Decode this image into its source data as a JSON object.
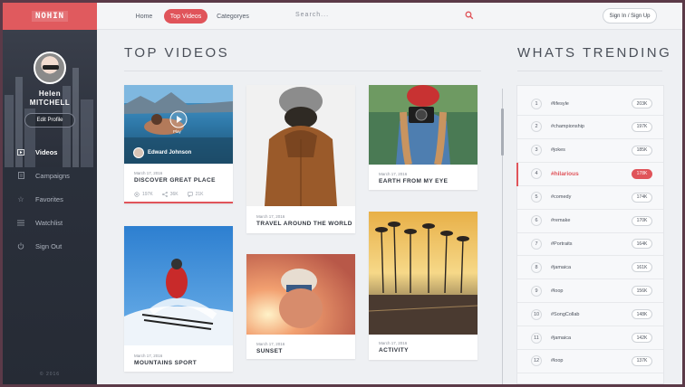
{
  "brand": {
    "logo_text": "NOHIN"
  },
  "profile": {
    "first_name": "Helen",
    "last_name": "MITCHELL",
    "edit_label": "Edit Profile"
  },
  "sidebar": {
    "items": [
      {
        "label": "Videos",
        "icon": "play-icon",
        "active": true
      },
      {
        "label": "Campaigns",
        "icon": "document-icon",
        "active": false
      },
      {
        "label": "Favorites",
        "icon": "star-icon",
        "active": false
      },
      {
        "label": "Watchlist",
        "icon": "list-icon",
        "active": false
      },
      {
        "label": "Sign Out",
        "icon": "power-icon",
        "active": false
      }
    ],
    "copyright": "© 2016"
  },
  "topnav": {
    "items": [
      {
        "label": "Home",
        "active": false
      },
      {
        "label": "Top Videos",
        "active": true
      },
      {
        "label": "Categoryes",
        "active": false
      }
    ],
    "search_placeholder": "Search...",
    "signin_label": "Sign In / Sign Up"
  },
  "sections": {
    "top_videos": "TOP VIDEOS",
    "trending": "WHATS TRENDING"
  },
  "videos": [
    {
      "date": "March 17, 2016",
      "title": "DISCOVER GREAT PLACE",
      "author": "Edward Johnson",
      "play_label": "Play",
      "views": "197K",
      "shares": "36K",
      "comments": "21K"
    },
    {
      "date": "March 17, 2016",
      "title": "MOUNTAINS SPORT"
    },
    {
      "date": "March 17, 2016",
      "title": "TRAVEL AROUND THE WORLD"
    },
    {
      "date": "March 17, 2016",
      "title": "SUNSET"
    },
    {
      "date": "March 17, 2016",
      "title": "EARTH FROM MY EYE"
    },
    {
      "date": "March 17, 2016",
      "title": "ACTIVITY"
    }
  ],
  "trending": [
    {
      "rank": "1",
      "tag": "#lifesyle",
      "count": "203K"
    },
    {
      "rank": "2",
      "tag": "#championship",
      "count": "197K"
    },
    {
      "rank": "3",
      "tag": "#jokes",
      "count": "185K"
    },
    {
      "rank": "4",
      "tag": "#hilarious",
      "count": "178K",
      "active": true
    },
    {
      "rank": "5",
      "tag": "#comedy",
      "count": "174K"
    },
    {
      "rank": "6",
      "tag": "#remake",
      "count": "170K"
    },
    {
      "rank": "7",
      "tag": "#Portraits",
      "count": "164K"
    },
    {
      "rank": "8",
      "tag": "#jamaica",
      "count": "161K"
    },
    {
      "rank": "9",
      "tag": "#loop",
      "count": "156K"
    },
    {
      "rank": "10",
      "tag": "#SongCollab",
      "count": "148K"
    },
    {
      "rank": "11",
      "tag": "#jamaica",
      "count": "142K"
    },
    {
      "rank": "12",
      "tag": "#loop",
      "count": "137K"
    }
  ],
  "colors": {
    "accent": "#e0545a",
    "sidebar": "#2b303b"
  }
}
